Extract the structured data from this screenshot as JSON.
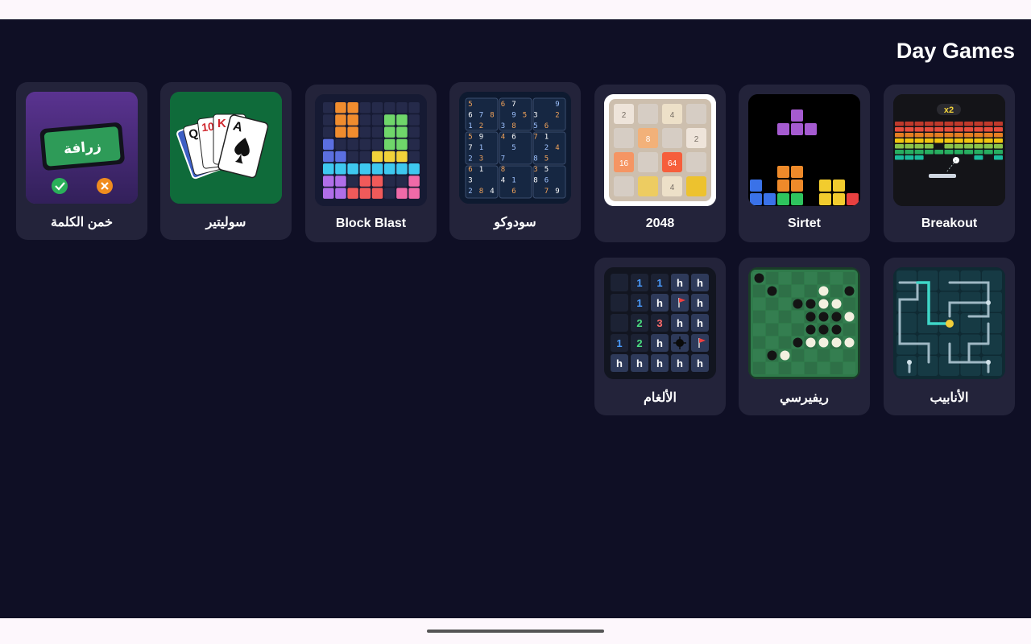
{
  "header": {
    "title": "Day Games"
  },
  "games": [
    {
      "label": "Breakout",
      "icon": "breakout-icon"
    },
    {
      "label": "Sirtet",
      "icon": "sirtet-icon"
    },
    {
      "label": "2048",
      "icon": "2048-icon",
      "tiles": [
        "2",
        "4",
        "8",
        "2",
        "16",
        "64"
      ]
    },
    {
      "label": "سودوكو",
      "icon": "sudoku-icon"
    },
    {
      "label": "Block Blast",
      "icon": "block-blast-icon"
    },
    {
      "label": "سوليتير",
      "icon": "solitaire-icon",
      "cards": [
        "Q",
        "10",
        "K",
        "A"
      ]
    },
    {
      "label": "خمن الكلمة",
      "icon": "guess-word-icon",
      "word": "زرافة"
    },
    {
      "label": "الأنابيب",
      "icon": "pipes-icon"
    },
    {
      "label": "ريفيرسي",
      "icon": "reversi-icon"
    },
    {
      "label": "الألغام",
      "icon": "minesweeper-icon",
      "numbers": [
        "1",
        "1",
        "1",
        "2",
        "3",
        "1",
        "2"
      ]
    }
  ],
  "colors": {
    "background": "#0f0f25",
    "card": "#23233a",
    "text": "#ffffff"
  }
}
